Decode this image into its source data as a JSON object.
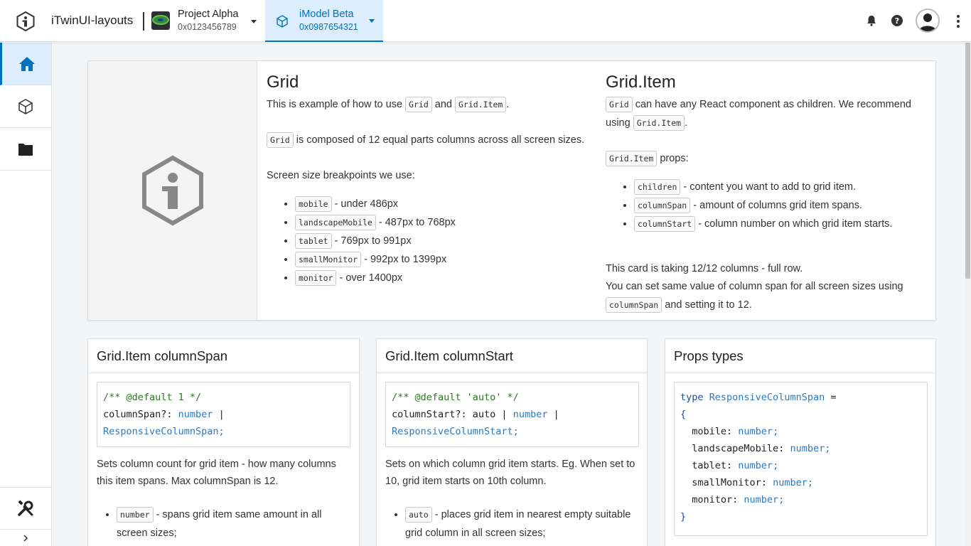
{
  "header": {
    "app_title": "iTwinUI-layouts",
    "project": {
      "name": "Project Alpha",
      "id": "0x0123456789"
    },
    "imodel": {
      "name": "iModel Beta",
      "id": "0x0987654321"
    },
    "icons": [
      "notification-bell-icon",
      "help-icon",
      "user-avatar",
      "more-options-icon"
    ]
  },
  "sidenav": {
    "items": [
      "home-icon",
      "model-cube-icon",
      "folder-icon"
    ],
    "bottom": "tools-icon",
    "expand": "chevron-right-icon"
  },
  "main_card": {
    "grid": {
      "title": "Grid",
      "intro_pre": "This is example of how to use ",
      "intro_code1": "Grid",
      "intro_mid": " and ",
      "intro_code2": "Grid.Item",
      "intro_post": ".",
      "composed_code": "Grid",
      "composed_text": " is composed of 12 equal parts columns across all screen sizes.",
      "breakpoints_title": "Screen size breakpoints we use:",
      "breakpoints": [
        {
          "code": "mobile",
          "text": " - under 486px"
        },
        {
          "code": "landscapeMobile",
          "text": " - 487px to 768px"
        },
        {
          "code": "tablet",
          "text": " - 769px to 991px"
        },
        {
          "code": "smallMonitor",
          "text": " - 992px to 1399px"
        },
        {
          "code": "monitor",
          "text": " - over 1400px"
        }
      ]
    },
    "grid_item": {
      "title": "Grid.Item",
      "p1_code": "Grid",
      "p1_text": " can have any React component as children. We recommend using ",
      "p1_code2": "Grid.Item",
      "p1_post": ".",
      "props_code": "Grid.Item",
      "props_text": " props:",
      "props": [
        {
          "code": "children",
          "text": " - content you want to add to grid item."
        },
        {
          "code": "columnSpan",
          "text": " - amount of columns grid item spans."
        },
        {
          "code": "columnStart",
          "text": " - column number on which grid item starts."
        }
      ],
      "footer1": "This card is taking 12/12 columns - full row.",
      "footer2": "You can set same value of column span for all screen sizes using ",
      "footer_code": "columnSpan",
      "footer_post": " and setting it to 12."
    }
  },
  "cards": {
    "column_span": {
      "title": "Grid.Item columnSpan",
      "code_comment": "/** @default 1 */",
      "code_prop": "columnSpan?: ",
      "code_num": "number",
      "code_pipe": " |",
      "code_type": "ResponsiveColumnSpan;",
      "desc": "Sets column count for grid item - how many columns this item spans. Max columnSpan is 12.",
      "list": [
        {
          "code": "number",
          "text": " - spans grid item same amount in all screen sizes;"
        }
      ]
    },
    "column_start": {
      "title": "Grid.Item columnStart",
      "code_comment": "/** @default 'auto' */",
      "code_prop": "columnStart?: auto | ",
      "code_num": "number",
      "code_pipe": " |",
      "code_type": "ResponsiveColumnStart;",
      "desc": "Sets on which column grid item starts. Eg. When set to 10, grid item starts on 10th column.",
      "list": [
        {
          "code": "auto",
          "text": " - places grid item in nearest empty suitable grid column in all screen sizes;"
        }
      ]
    },
    "props_types": {
      "title": "Props types",
      "kw": "type",
      "type_name": "ResponsiveColumnSpan",
      "eq": " =",
      "open": "{",
      "fields": [
        {
          "name": "mobile: ",
          "type": "number;"
        },
        {
          "name": "landscapeMobile: ",
          "type": "number;"
        },
        {
          "name": "tablet: ",
          "type": "number;"
        },
        {
          "name": "smallMonitor: ",
          "type": "number;"
        },
        {
          "name": "monitor: ",
          "type": "number;"
        }
      ],
      "close": "}"
    }
  },
  "colors": {
    "accent": "#0073ba",
    "accent_bg": "#dceefd",
    "page_bg": "#f4f5f6"
  }
}
